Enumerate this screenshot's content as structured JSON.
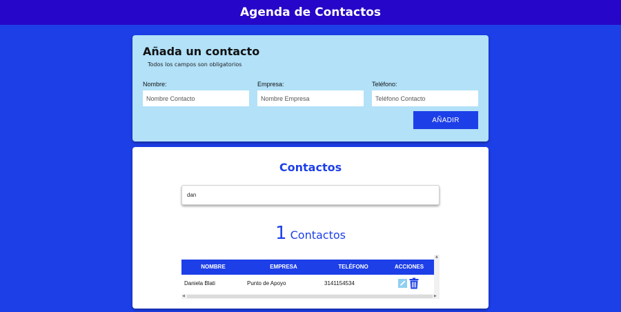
{
  "header": {
    "title": "Agenda de Contactos"
  },
  "form": {
    "title": "Añada un contacto",
    "subtitle": "Todos los campos son obligatorios",
    "fields": [
      {
        "label": "Nombre:",
        "placeholder": "Nombre Contacto",
        "value": ""
      },
      {
        "label": "Empresa:",
        "placeholder": "Nombre Empresa",
        "value": ""
      },
      {
        "label": "Teléfono:",
        "placeholder": "Teléfono Contacto",
        "value": ""
      }
    ],
    "submit_label": "AÑADIR"
  },
  "contacts": {
    "title": "Contactos",
    "search": {
      "value": "dan",
      "placeholder": ""
    },
    "count": "1",
    "count_label": "Contactos",
    "table": {
      "headers": [
        "NOMBRE",
        "EMPRESA",
        "TELÉFONO",
        "ACCIONES"
      ],
      "rows": [
        {
          "nombre": "Daniela Blati",
          "empresa": "Punto de Apoyo",
          "telefono": "3141154534",
          "actions": [
            "pencil-icon",
            "trash-icon"
          ]
        }
      ]
    }
  },
  "colors": {
    "page_bg": "#1d3fe8",
    "header_bg": "#2606c8",
    "form_card_bg": "#b2e1f8",
    "accent": "#1d3fe8",
    "edit_button": "#8fd0f2"
  }
}
